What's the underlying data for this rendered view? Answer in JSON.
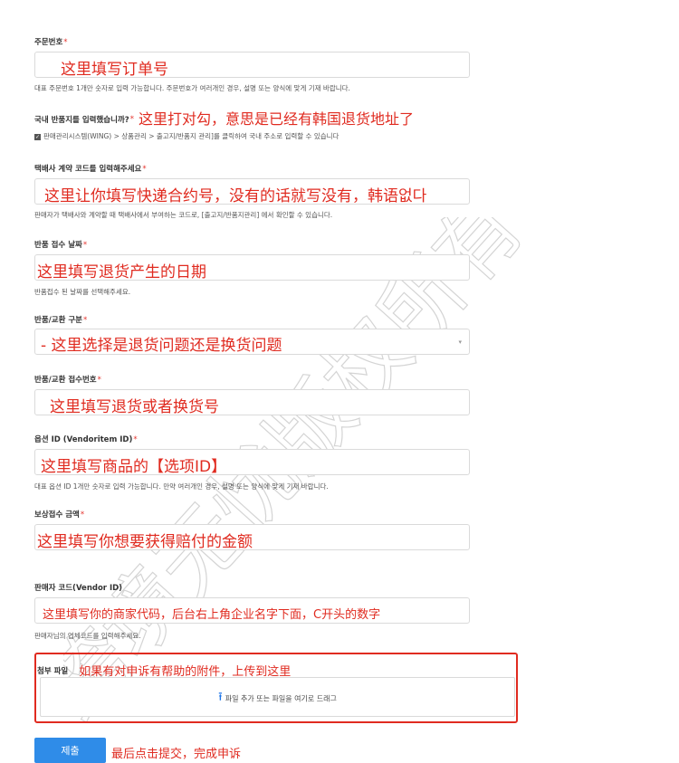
{
  "fields": {
    "order_no": {
      "label": "주문번호",
      "value": "这里填写订单号",
      "help": "대표 주문번호 1개만 숫자로 입력 가능합니다. 주문번호가 여러개인 경우, 설명 또는 양식에 맞게 기재 바랍니다."
    },
    "domestic_return": {
      "label": "국내 반품지를 입력했습니까?",
      "annotation": "这里打对勾，意思是已经有韩国退货地址了",
      "help": "판매관리시스템(WING) > 상품관리 > 출고지/반품지 관리]를 클릭하여 국내 주소로 입력할 수 있습니다"
    },
    "courier_code": {
      "label": "택배사 계약 코드를 입력해주세요",
      "value": "这里让你填写快递合约号，没有的话就写没有，韩语없다",
      "help": "판매자가 택배사와 계약할 때 택배사에서 부여하는 코드로, [출고지/반품지관리] 에서 확인할 수 있습니다."
    },
    "return_date": {
      "label": "반품 접수 날짜",
      "value": "这里填写退货产生的日期",
      "help": "반품접수 된 날짜를 선택해주세요."
    },
    "return_type": {
      "label": "반품/교환 구분",
      "value": "- 这里选择是退货问题还是换货问题"
    },
    "return_no": {
      "label": "반품/교환 접수번호",
      "value": "这里填写退货或者换货号"
    },
    "option_id": {
      "label": "옵션 ID (Vendoritem ID)",
      "value": "这里填写商品的【选项ID】",
      "help": "대표 옵션 ID 1개만 숫자로 입력 가능합니다. 만약 여러개인 경우, 설명 또는 양식에 맞게 기재 바랍니다."
    },
    "compensation": {
      "label": "보상접수 금액",
      "value": "这里填写你想要获得赔付的金额"
    },
    "vendor_code": {
      "label": "판매자 코드(Vendor ID)",
      "value": "这里填写你的商家代码，后台右上角企业名字下面，C开头的数字",
      "help": "판매자님의 업체코드를 입력해주세요."
    },
    "attachment": {
      "label": "첨부 파일",
      "annotation": "如果有对申诉有帮助的附件，上传到这里",
      "upload_text": "파일 추가 또는 파일을 여기로 드래그"
    }
  },
  "required_mark": "*",
  "submit": {
    "label": "제출",
    "annotation": "最后点击提交，完成申诉"
  },
  "watermark_text": "跨境无忧版权所有",
  "colors": {
    "annotation_red": "#e02b20",
    "primary_blue": "#2f8ce8",
    "border_gray": "#dadada"
  }
}
